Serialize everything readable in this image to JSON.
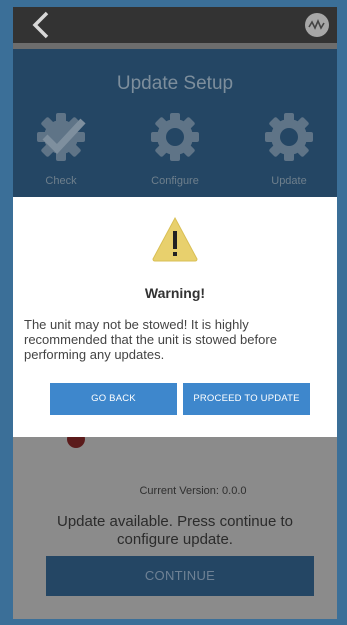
{
  "header": {
    "title": "Update Setup",
    "steps": [
      {
        "label": "Check",
        "icon": "check-gear-icon"
      },
      {
        "label": "Configure",
        "icon": "gear-icon"
      },
      {
        "label": "Update",
        "icon": "gear-icon"
      }
    ]
  },
  "topbar": {
    "back_icon": "chevron-left-icon",
    "logo_icon": "wave-logo-icon"
  },
  "dialog": {
    "icon": "warning-triangle-icon",
    "title": "Warning!",
    "message": "The unit may not be stowed! It is highly recommended that the unit is stowed before performing any updates.",
    "go_back_label": "GO BACK",
    "proceed_label": "PROCEED TO UPDATE"
  },
  "main": {
    "current_version": "Current Version: 0.0.0",
    "update_message": "Update available. Press continue to configure update.",
    "continue_label": "CONTINUE"
  },
  "colors": {
    "accent": "#3e87cc",
    "header_bg": "#244664",
    "warning": "#e8d06d"
  }
}
